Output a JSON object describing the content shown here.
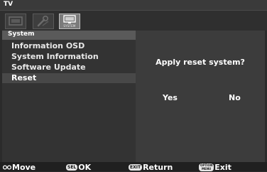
{
  "window": {
    "title": "TV"
  },
  "tabs": [
    {
      "icon": "picture-icon",
      "caption": ""
    },
    {
      "icon": "tools-icon",
      "caption": ""
    },
    {
      "icon": "monitor-icon",
      "caption": "SYSTEM",
      "active": true
    }
  ],
  "menu": {
    "section": "System",
    "items": [
      {
        "label": "Information OSD"
      },
      {
        "label": "System Information"
      },
      {
        "label": "Software Update"
      },
      {
        "label": "Reset",
        "selected": true
      }
    ]
  },
  "dialog": {
    "prompt": "Apply reset system?",
    "yes": "Yes",
    "no": "No"
  },
  "footer": {
    "move_label": "Move",
    "ok_key": "SEL",
    "ok_label": "OK",
    "return_key": "EXIT",
    "return_label": "Return",
    "exit_key_top": "OPTION",
    "exit_key_bottom": "MENU",
    "exit_label": "Exit"
  },
  "colors": {
    "background": "#2b2b2b",
    "panel": "#3b3b3b",
    "section_header": "#5a5a5a",
    "selected_row": "#484848",
    "text": "#ffffff"
  }
}
